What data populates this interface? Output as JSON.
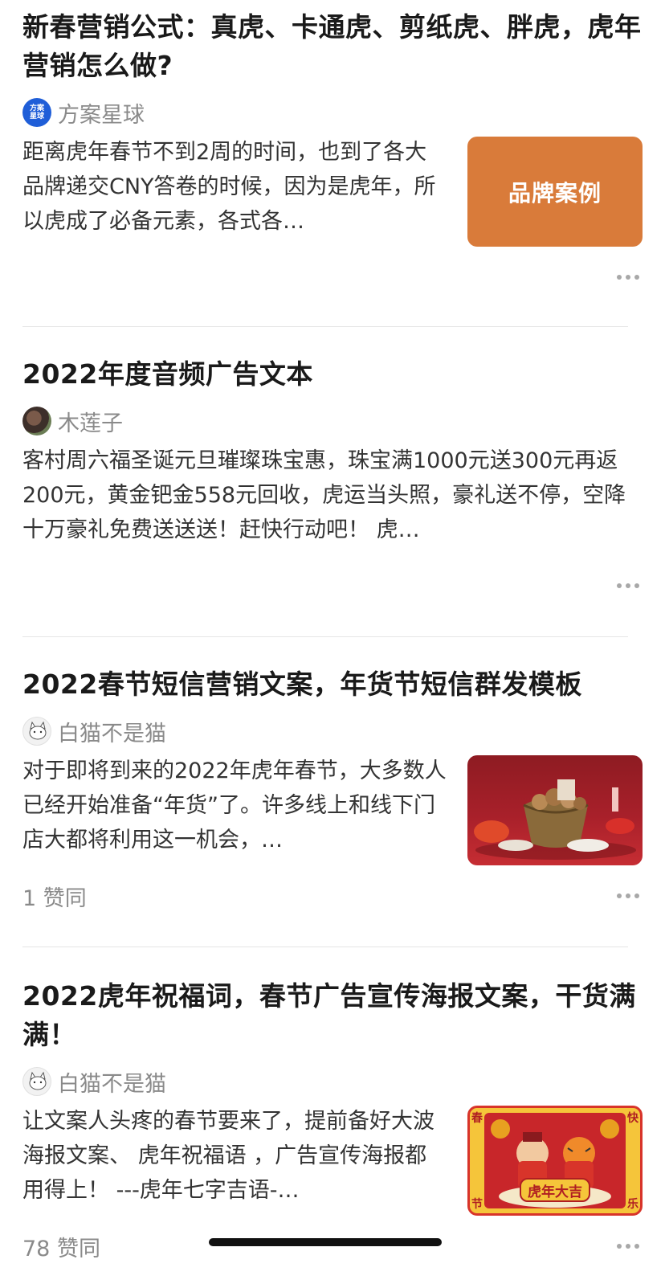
{
  "feed": [
    {
      "title": "新春营销公式：真虎、卡通虎、剪纸虎、胖虎，虎年营销怎么做?",
      "author": "方案星球",
      "avatar_text": "方案星球",
      "excerpt": "距离虎年春节不到2周的时间，也到了各大品牌递交CNY答卷的时候，因为是虎年，所以虎成了必备元素，各式各…",
      "thumb_label": "品牌案例",
      "votes": ""
    },
    {
      "title": "2022年度音频广告文本",
      "author": "木莲子",
      "excerpt": "客村周六福圣诞元旦璀璨珠宝惠，珠宝满1000元送300元再返200元，黄金钯金558元回收，虎运当头照，豪礼送不停，空降十万豪礼免费送送送！赶快行动吧！ 虎…",
      "votes": ""
    },
    {
      "title": "2022春节短信营销文案，年货节短信群发模板",
      "author": "白猫不是猫",
      "excerpt": "对于即将到来的2022年虎年春节，大多数人已经开始准备“年货”了。许多线上和线下门店大都将利用这一机会，…",
      "votes": "1 赞同"
    },
    {
      "title": "2022虎年祝福词，春节广告宣传海报文案，干货满满！",
      "author": "白猫不是猫",
      "excerpt": "让文案人头疼的春节要来了，提前备好大波海报文案、 虎年祝福语 ，广告宣传海报都用得上！ ---虎年七字吉语-…",
      "poster": {
        "corner_tl": "春",
        "corner_tr": "快",
        "corner_bl": "节",
        "corner_br": "乐",
        "banner": "虎年大吉"
      },
      "votes": "78 赞同"
    }
  ],
  "colors": {
    "brand_thumb": "#d97b3a",
    "divider": "#e5e5e5",
    "meta_text": "#8a8a8a"
  }
}
